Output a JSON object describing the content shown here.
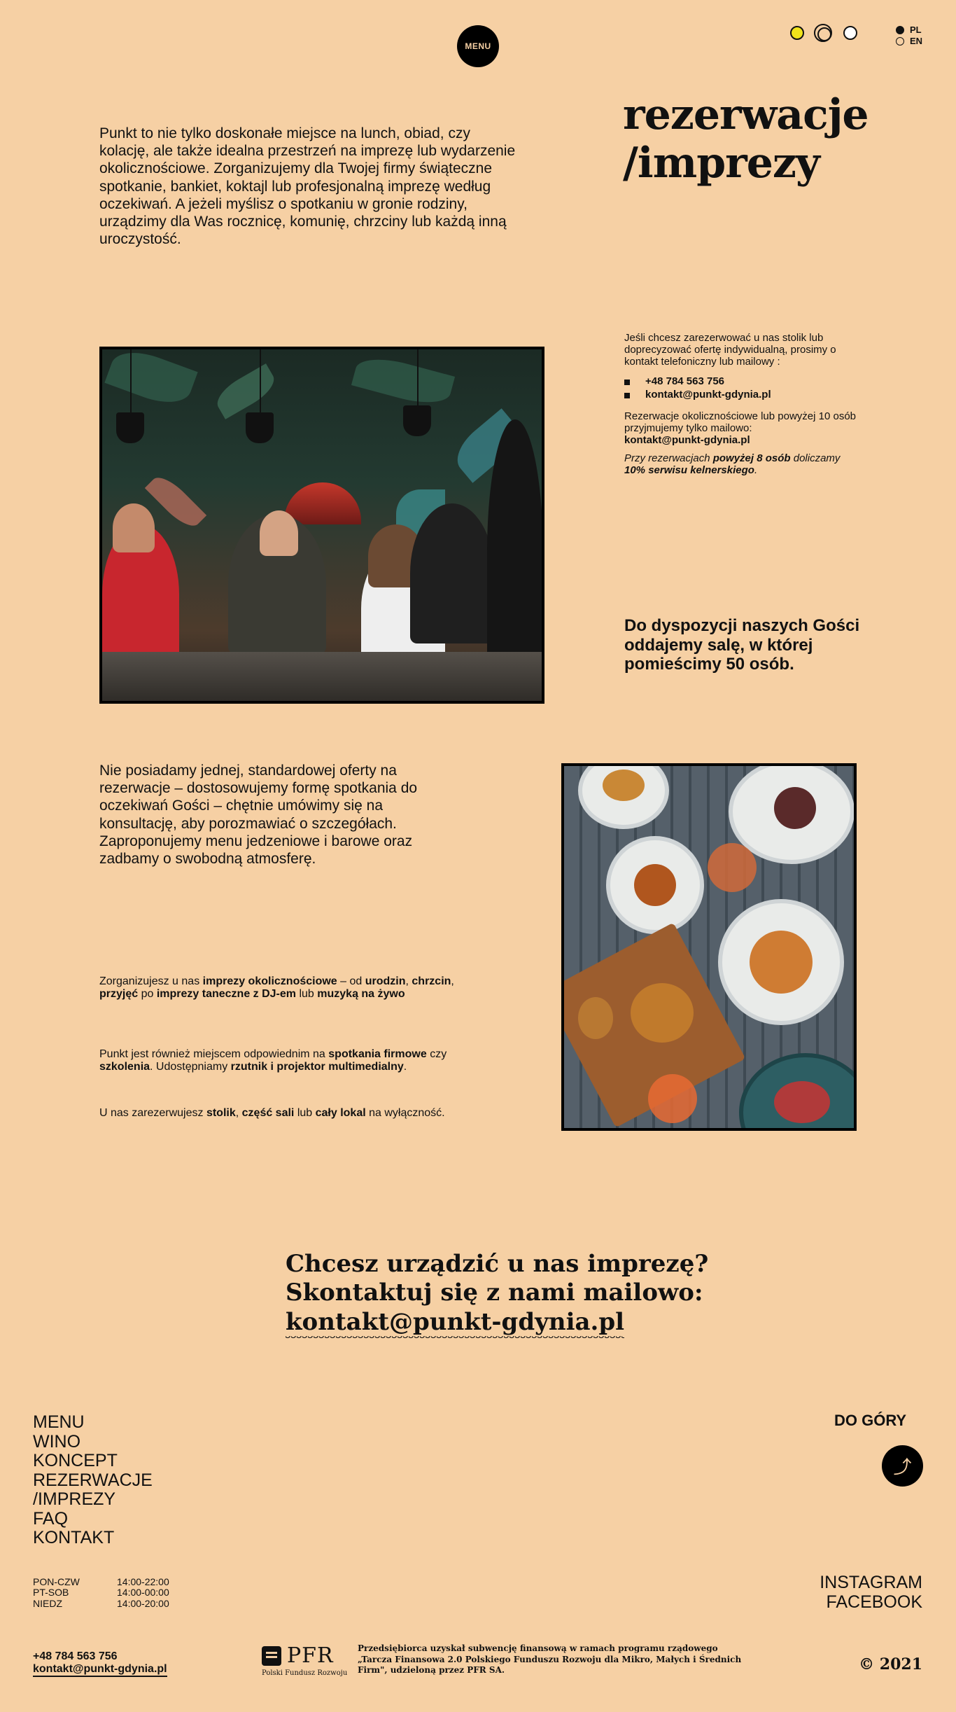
{
  "header": {
    "menu_label": "MENU",
    "languages": [
      "PL",
      "EN"
    ],
    "active_language": "PL"
  },
  "intro": {
    "text": "Punkt to nie tylko doskonałe miejsce na lunch, obiad, czy kolację, ale także idealna przestrzeń na imprezę lub wydarzenie okolicznościowe. Zorganizujemy dla Twojej firmy świąteczne spotkanie, bankiet, koktajl lub profesjonalną imprezę według oczekiwań. A jeżeli myślisz o spotkaniu w gronie rodziny, urządzimy dla Was rocznicę, komunię, chrzciny lub każdą inną uroczystość.",
    "title_line1": "rezerwacje",
    "title_line2": "/imprezy"
  },
  "info": {
    "p1": "Jeśli chcesz zarezerwować u nas stolik lub doprecyzować ofertę indywidualną, prosimy o kontakt telefoniczny lub mailowy :",
    "phone": "+48 784 563 756",
    "email": "kontakt@punkt-gdynia.pl",
    "p2": "Rezerwacje okolicznościowe lub powyżej 10 osób przyjmujemy tylko mailowo:",
    "p2_email": "kontakt@punkt-gdynia.pl",
    "note_pre": "Przy rezerwacjach ",
    "note_b1": "powyżej 8 osób",
    "note_mid": " doliczamy ",
    "note_b2": "10% serwisu kelnerskiego",
    "note_end": "."
  },
  "capacity": "Do dyspozycji naszych Gości oddajemy salę, w której pomieścimy 50 osób.",
  "offer": {
    "text": "Nie posiadamy jednej, standardowej oferty na rezerwacje – dostosowujemy formę spotkania do oczekiwań Gości – chętnie umówimy się na konsultację, aby porozmawiać o szczegółach. Zaproponujemy menu jedzeniowe i barowe oraz zadbamy o swobodną atmosferę.",
    "events": {
      "t1": "Zorganizujesz u nas ",
      "b1": "imprezy okolicznościowe",
      "t2": " – od ",
      "b2": "urodzin",
      "t3": ", ",
      "b3": "chrzcin",
      "t4": ", ",
      "b4": "przyjęć",
      "t5": " po ",
      "b5": "imprezy taneczne z DJ-em",
      "t6": " lub ",
      "b6": "muzyką na żywo"
    },
    "business": {
      "t1": "Punkt jest również miejscem odpowiednim na ",
      "b1": "spotkania firmowe",
      "t2": " czy ",
      "b2": "szkolenia",
      "t3": ". Udostępniamy ",
      "b3": "rzutnik i projektor multimedialny",
      "t4": "."
    },
    "booking": {
      "t1": "U nas zarezerwujesz ",
      "b1": "stolik",
      "t2": ", ",
      "b2": "część sali",
      "t3": " lub ",
      "b3": "cały lokal",
      "t4": " na wyłączność."
    }
  },
  "cta": {
    "line1": "Chcesz urządzić u nas imprezę?",
    "line2": "Skontaktuj się z nami mailowo:",
    "email": "kontakt@punkt-gdynia.pl"
  },
  "footer": {
    "nav": [
      "MENU",
      "WINO",
      "KONCEPT",
      "REZERWACJE",
      "/IMPREZY",
      "FAQ",
      "KONTAKT"
    ],
    "to_top_label": "DO GÓRY",
    "to_top_icon": "⤴",
    "hours": [
      {
        "days": "PON-CZW",
        "time": "14:00-22:00"
      },
      {
        "days": "PT-SOB",
        "time": "14:00-00:00"
      },
      {
        "days": "NIEDZ",
        "time": "14:00-20:00"
      }
    ],
    "social": [
      "INSTAGRAM",
      "FACEBOOK"
    ],
    "phone": "+48 784 563 756",
    "email": "kontakt@punkt-gdynia.pl",
    "pfr_name": "PFR",
    "pfr_sub": "Polski Fundusz Rozwoju",
    "pfr_info": "Przedsiębiorca uzyskał subwencję finansową w ramach programu rządowego „Tarcza Finansowa 2.0 Polskiego Funduszu Rozwoju dla Mikro, Małych i Średnich Firm\", udzieloną przez PFR SA.",
    "copyright": "© 2021"
  },
  "colors": {
    "background": "#f6d0a4",
    "text": "#111111",
    "accent_yellow": "#f1e31b"
  }
}
